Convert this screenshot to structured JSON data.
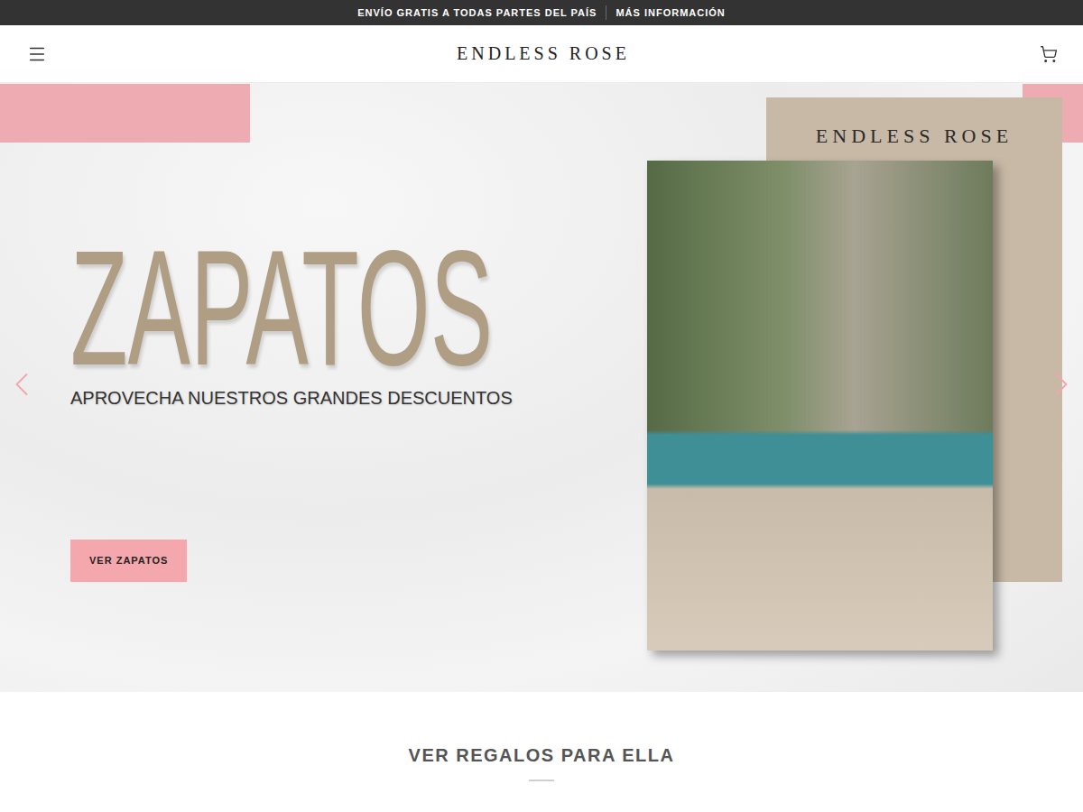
{
  "announcement": {
    "items": [
      "ENVÍO GRATIS A TODAS PARTES DEL PAÍS",
      "MÁS INFORMACIÓN"
    ]
  },
  "header": {
    "logo": "ENDLESS ROSE"
  },
  "hero": {
    "title": "ZAPATOS",
    "subtitle": "APROVECHA NUESTROS GRANDES DESCUENTOS",
    "button": "VER ZAPATOS",
    "panel_logo": "ENDLESS ROSE"
  },
  "section": {
    "title": "VER REGALOS PARA ELLA"
  }
}
